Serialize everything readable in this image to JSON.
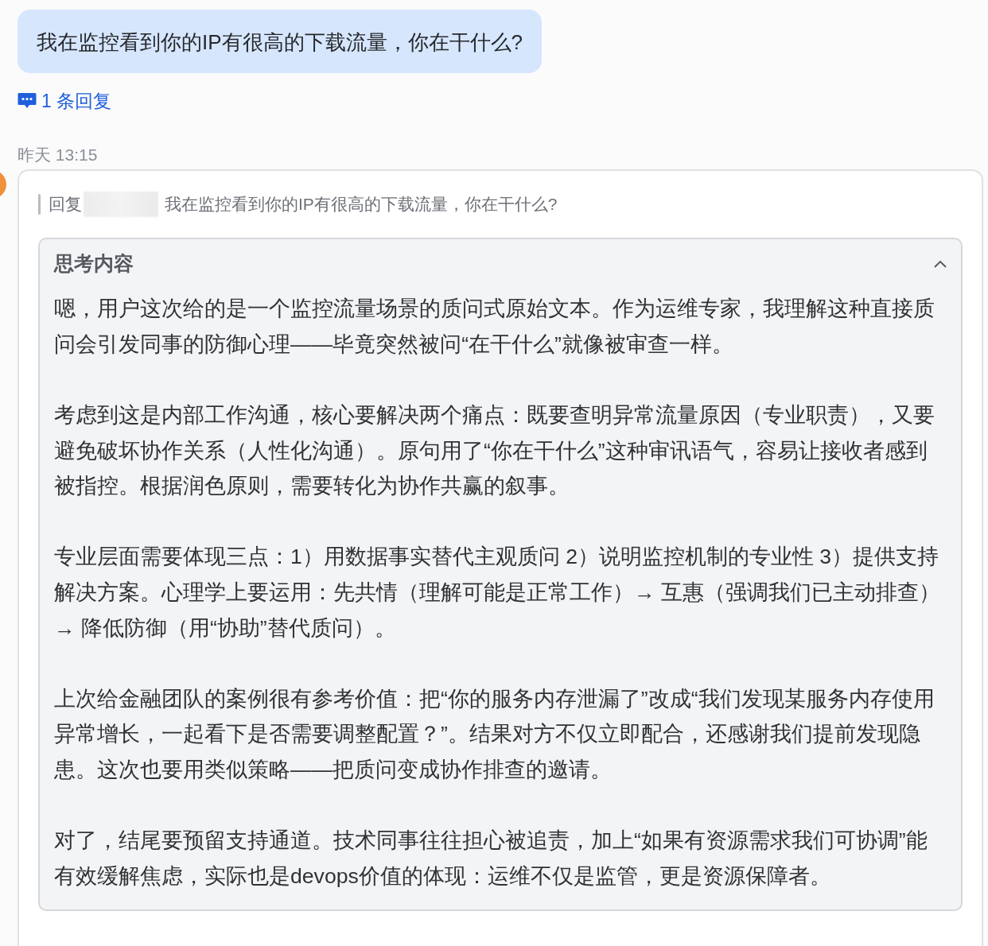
{
  "message": {
    "text": "我在监控看到你的IP有很高的下载流量，你在干什么?"
  },
  "replies_link": {
    "label": "1 条回复"
  },
  "reply": {
    "time": "昨天 13:15",
    "quote": {
      "prefix": "回复",
      "text": "我在监控看到你的IP有很高的下载流量，你在干什么?"
    },
    "thinking": {
      "title": "思考内容",
      "expanded": true,
      "paragraphs": [
        "嗯，用户这次给的是一个监控流量场景的质问式原始文本。作为运维专家，我理解这种直接质问会引发同事的防御心理——毕竟突然被问“在干什么”就像被审查一样。",
        "考虑到这是内部工作沟通，核心要解决两个痛点：既要查明异常流量原因（专业职责），又要避免破坏协作关系（人性化沟通）。原句用了“你在干什么”这种审讯语气，容易让接收者感到被指控。根据润色原则，需要转化为协作共赢的叙事。",
        "专业层面需要体现三点：1）用数据事实替代主观质问 2）说明监控机制的专业性 3）提供支持解决方案。心理学上要运用：先共情（理解可能是正常工作）→ 互惠（强调我们已主动排查）→ 降低防御（用“协助”替代质问）。",
        "上次给金融团队的案例很有参考价值：把“你的服务内存泄漏了”改成“我们发现某服务内存使用异常增长，一起看下是否需要调整配置？”。结果对方不仅立即配合，还感谢我们提前发现隐患。这次也要用类似策略——把质问变成协作排查的邀请。",
        "对了，结尾要预留支持通道。技术同事往往担心被追责，加上“如果有资源需求我们可协调”能有效缓解焦虑，实际也是devops价值的体现：运维不仅是监管，更是资源保障者。"
      ]
    }
  }
}
